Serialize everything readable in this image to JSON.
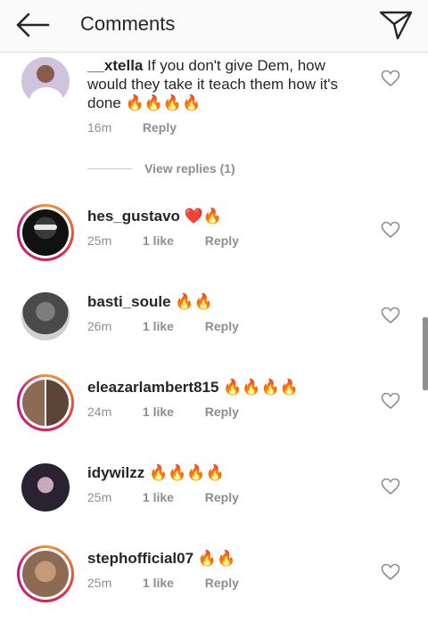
{
  "header": {
    "title": "Comments",
    "back_icon": "arrow-left-icon",
    "direct_icon": "paper-plane-icon"
  },
  "comments": [
    {
      "username": "__xtella",
      "text": "If you don't give Dem, how would they take it teach them how it's done 🔥🔥🔥🔥",
      "time": "16m",
      "likes": "",
      "reply": "Reply",
      "has_story_ring": false
    },
    {
      "username": "hes_gustavo",
      "text": "❤️🔥",
      "time": "25m",
      "likes": "1 like",
      "reply": "Reply",
      "has_story_ring": true
    },
    {
      "username": "basti_soule",
      "text": "🔥🔥",
      "time": "26m",
      "likes": "1 like",
      "reply": "Reply",
      "has_story_ring": false
    },
    {
      "username": "eleazarlambert815",
      "text": "🔥🔥🔥🔥",
      "time": "24m",
      "likes": "1 like",
      "reply": "Reply",
      "has_story_ring": true
    },
    {
      "username": "idywilzz",
      "text": "🔥🔥🔥🔥",
      "time": "25m",
      "likes": "1 like",
      "reply": "Reply",
      "has_story_ring": false
    },
    {
      "username": "stephofficial07",
      "text": "🔥🔥",
      "time": "25m",
      "likes": "1 like",
      "reply": "Reply",
      "has_story_ring": true
    }
  ],
  "view_replies": "View replies (1)",
  "colors": {
    "text": "#262626",
    "muted": "#8e8e8e",
    "story_ring": [
      "#f09433",
      "#dc2743",
      "#bc1888"
    ]
  }
}
